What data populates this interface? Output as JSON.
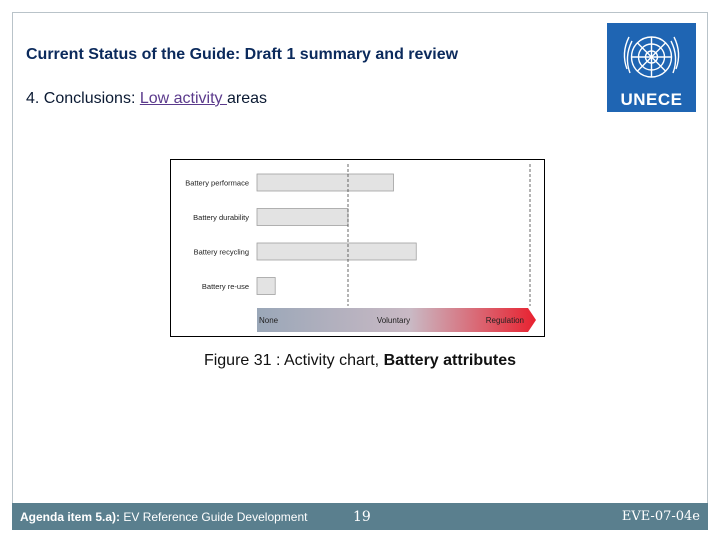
{
  "header": {
    "title": "Current Status of the Guide: Draft 1 summary and review",
    "subtitle_prefix": "4.  Conclusions: ",
    "subtitle_link": "Low activity ",
    "subtitle_suffix": "areas"
  },
  "logo": {
    "text": "UNECE",
    "brand_color": "#1f65b3"
  },
  "caption": {
    "prefix": "Figure 31 : Activity chart, ",
    "bold": "Battery attributes"
  },
  "footer": {
    "agenda_label": "Agenda item 5.a):",
    "agenda_text": " EV Reference Guide Development",
    "page_number": "19",
    "doc_code": "EVE-07-04e"
  },
  "chart_data": {
    "type": "bar",
    "orientation": "horizontal",
    "categories": [
      "Battery performace",
      "Battery durability",
      "Battery recycling",
      "Battery re-use"
    ],
    "values": [
      1.5,
      1.0,
      1.75,
      0.2
    ],
    "xlim": [
      0,
      3
    ],
    "x_levels": [
      "None",
      "Voluntary",
      "Regulation"
    ],
    "dashed_lines_at": [
      1,
      3
    ],
    "bar_color": "#e3e3e3",
    "arrow_colors": [
      "#9aa7b8",
      "#e8212f"
    ]
  }
}
